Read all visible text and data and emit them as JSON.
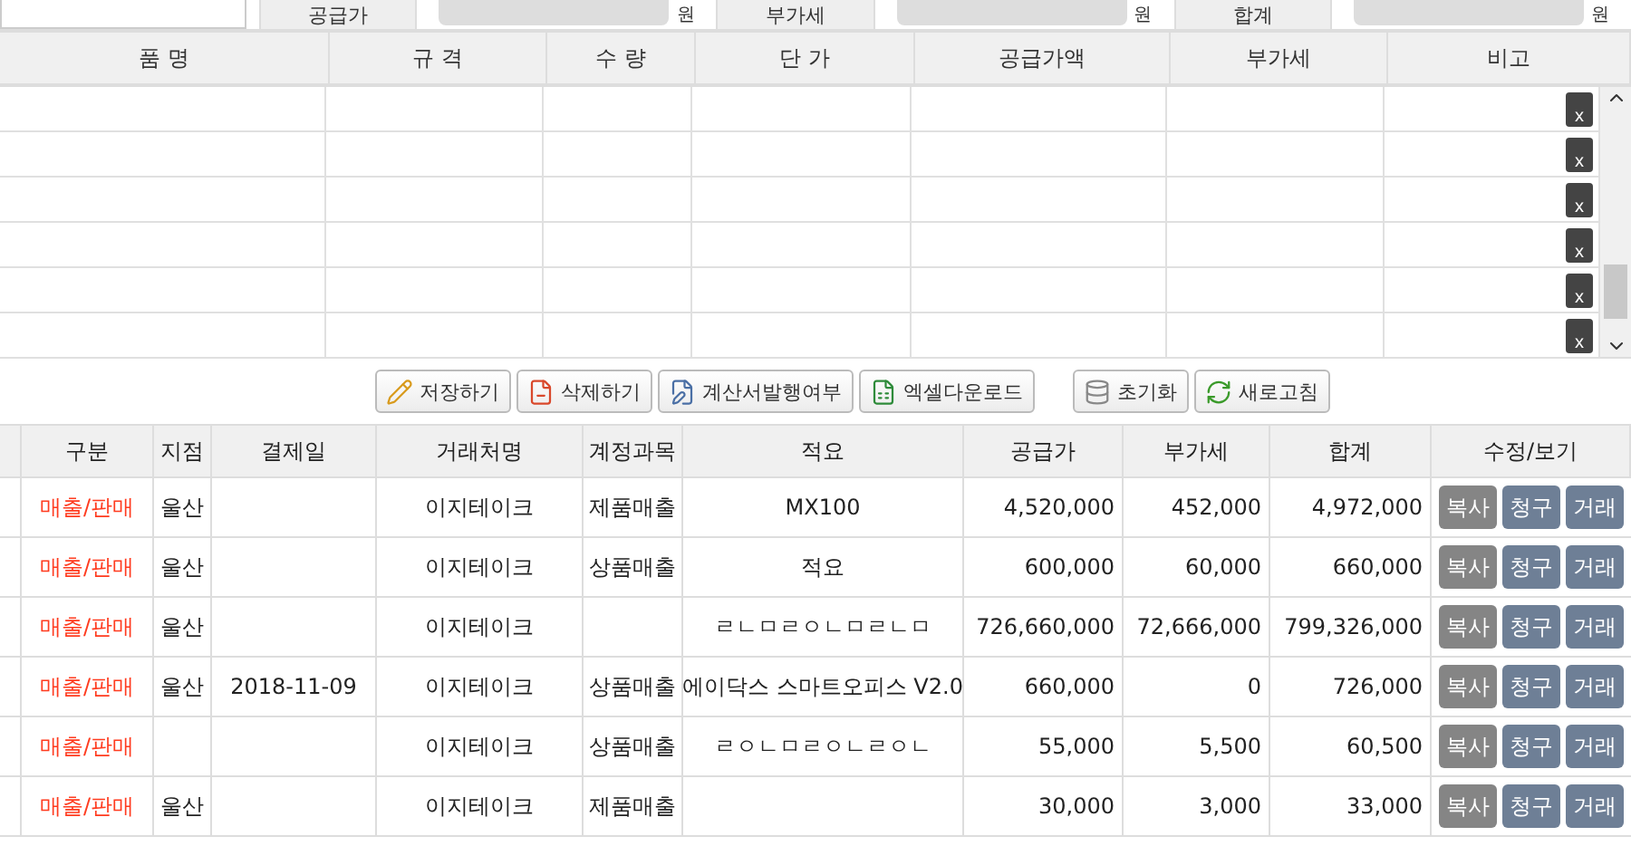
{
  "summary": {
    "items": [
      {
        "label": "공급가",
        "unit": "원"
      },
      {
        "label": "부가세",
        "unit": "원"
      },
      {
        "label": "합계",
        "unit": "원"
      }
    ]
  },
  "item_table": {
    "columns": [
      "품 명",
      "규 격",
      "수 량",
      "단 가",
      "공급가액",
      "부가세",
      "비고"
    ],
    "rows": [
      {
        "delete": "x"
      },
      {
        "delete": "x"
      },
      {
        "delete": "x"
      },
      {
        "delete": "x"
      },
      {
        "delete": "x"
      },
      {
        "delete": "x"
      }
    ]
  },
  "toolbar": [
    {
      "kind": "save",
      "label": "저장하기"
    },
    {
      "kind": "delete",
      "label": "삭제하기"
    },
    {
      "kind": "invoice",
      "label": "계산서발행여부"
    },
    {
      "kind": "excel",
      "label": "엑셀다운로드"
    },
    {
      "kind": "reset",
      "label": "초기화"
    },
    {
      "kind": "refresh",
      "label": "새로고침"
    }
  ],
  "list_table": {
    "columns": [
      "구분",
      "지점",
      "결제일",
      "거래처명",
      "계정과목",
      "적요",
      "공급가",
      "부가세",
      "합계",
      "수정/보기"
    ],
    "rows": [
      {
        "type": "매출/판매",
        "branch": "울산",
        "client": "이지테이크",
        "account": "제품매출",
        "memo": "MX100",
        "supply": "4,520,000",
        "vat": "452,000",
        "total": "4,972,000",
        "actions": [
          {
            "kind": "copy",
            "label": "복사"
          },
          {
            "kind": "bill",
            "label": "청구"
          },
          {
            "kind": "trade",
            "label": "거래"
          }
        ]
      },
      {
        "type": "매출/판매",
        "branch": "울산",
        "client": "이지테이크",
        "account": "상품매출",
        "memo": "적요",
        "supply": "600,000",
        "vat": "60,000",
        "total": "660,000",
        "actions": [
          {
            "kind": "copy",
            "label": "복사"
          },
          {
            "kind": "bill",
            "label": "청구"
          },
          {
            "kind": "trade",
            "label": "거래"
          }
        ]
      },
      {
        "type": "매출/판매",
        "branch": "울산",
        "client": "이지테이크",
        "memo": "ㄹㄴㅁㄹㅇㄴㅁㄹㄴㅁ",
        "supply": "726,660,000",
        "vat": "72,666,000",
        "total": "799,326,000",
        "actions": [
          {
            "kind": "copy",
            "label": "복사"
          },
          {
            "kind": "bill",
            "label": "청구"
          },
          {
            "kind": "trade",
            "label": "거래"
          }
        ]
      },
      {
        "type": "매출/판매",
        "branch": "울산",
        "date": "2018-11-09",
        "client": "이지테이크",
        "account": "상품매출",
        "memo": "에이닥스 스마트오피스 V2.0",
        "supply": "660,000",
        "vat": "0",
        "total": "726,000",
        "actions": [
          {
            "kind": "copy",
            "label": "복사"
          },
          {
            "kind": "bill",
            "label": "청구"
          },
          {
            "kind": "trade",
            "label": "거래"
          }
        ]
      },
      {
        "type": "매출/판매",
        "client": "이지테이크",
        "account": "상품매출",
        "memo": "ㄹㅇㄴㅁㄹㅇㄴㄹㅇㄴ",
        "supply": "55,000",
        "vat": "5,500",
        "total": "60,500",
        "actions": [
          {
            "kind": "copy",
            "label": "복사"
          },
          {
            "kind": "bill",
            "label": "청구"
          },
          {
            "kind": "trade",
            "label": "거래"
          }
        ]
      },
      {
        "type": "매출/판매",
        "branch": "울산",
        "client": "이지테이크",
        "account": "제품매출",
        "supply": "30,000",
        "vat": "3,000",
        "total": "33,000",
        "actions": [
          {
            "kind": "copy",
            "label": "복사"
          },
          {
            "kind": "bill",
            "label": "청구"
          },
          {
            "kind": "trade",
            "label": "거래"
          }
        ]
      }
    ]
  }
}
